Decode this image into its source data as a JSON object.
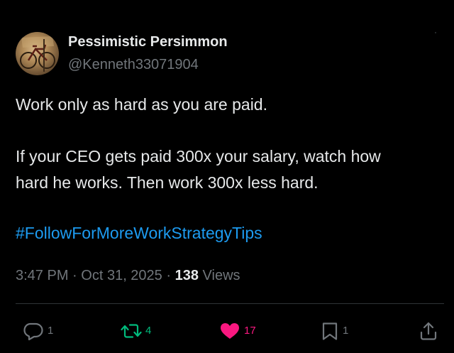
{
  "author": {
    "display_name": "Pessimistic Persimmon",
    "handle": "@Kenneth33071904"
  },
  "post": {
    "line1": "Work only as hard as you are paid.",
    "line2": "If your CEO gets paid 300x your salary, watch how",
    "line3": "hard he works.  Then work 300x less hard.",
    "hashtag": "#FollowForMoreWorkStrategyTips"
  },
  "meta": {
    "time": "3:47 PM",
    "separator1": "·",
    "date": "Oct 31, 2025",
    "separator2": "·",
    "views_count": "138",
    "views_label": "Views"
  },
  "actions": {
    "reply_count": "1",
    "retweet_count": "4",
    "like_count": "17",
    "bookmark_count": "1"
  },
  "icons": {
    "avatar": "bicycle-photo",
    "reply": "reply-icon",
    "retweet": "retweet-icon",
    "like": "heart-icon",
    "bookmark": "bookmark-icon",
    "share": "share-icon"
  },
  "colors": {
    "background": "#000000",
    "text": "#e7e9ea",
    "muted": "#71767b",
    "link": "#1d9bf0",
    "retweet_active": "#00ba7c",
    "like_active": "#f91880",
    "divider": "#2f3336"
  }
}
